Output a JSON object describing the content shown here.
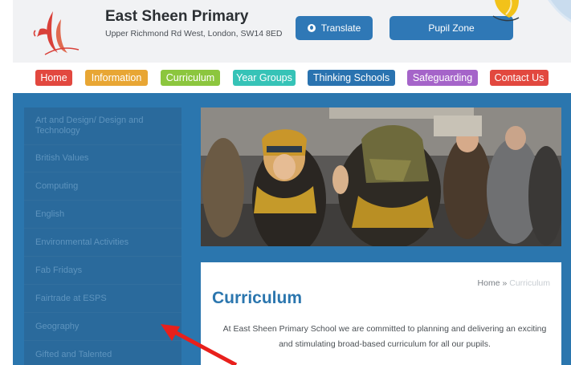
{
  "header": {
    "school_name": "East Sheen Primary",
    "address": "Upper Richmond Rd West, London, SW14 8ED",
    "translate_label": "Translate",
    "pupil_zone_label": "Pupil Zone"
  },
  "nav": {
    "items": [
      {
        "label": "Home",
        "color": "#e2483f"
      },
      {
        "label": "Information",
        "color": "#e8a634"
      },
      {
        "label": "Curriculum",
        "color": "#8cc63e"
      },
      {
        "label": "Year Groups",
        "color": "#36c3b7"
      },
      {
        "label": "Thinking Schools",
        "color": "#2a73b0"
      },
      {
        "label": "Safeguarding",
        "color": "#a564c9"
      },
      {
        "label": "Contact Us",
        "color": "#e2483f"
      }
    ]
  },
  "sidebar": {
    "items": [
      "Art and Design/ Design and Technology",
      "British Values",
      "Computing",
      "English",
      "Environmental Activities",
      "Fab Fridays",
      "Fairtrade at ESPS",
      "Geography",
      "Gifted and Talented"
    ]
  },
  "content": {
    "breadcrumb_home": "Home",
    "breadcrumb_sep": "»",
    "breadcrumb_current": "Curriculum",
    "title": "Curriculum",
    "intro": "At East Sheen Primary School we are committed to planning and delivering an exciting and stimulating broad-based curriculum for all our pupils."
  },
  "colors": {
    "blue_area": "#2b76ae",
    "sidebar": "#2a6a9c",
    "button_blue": "#2f78b6",
    "arrow": "#e8201c"
  }
}
